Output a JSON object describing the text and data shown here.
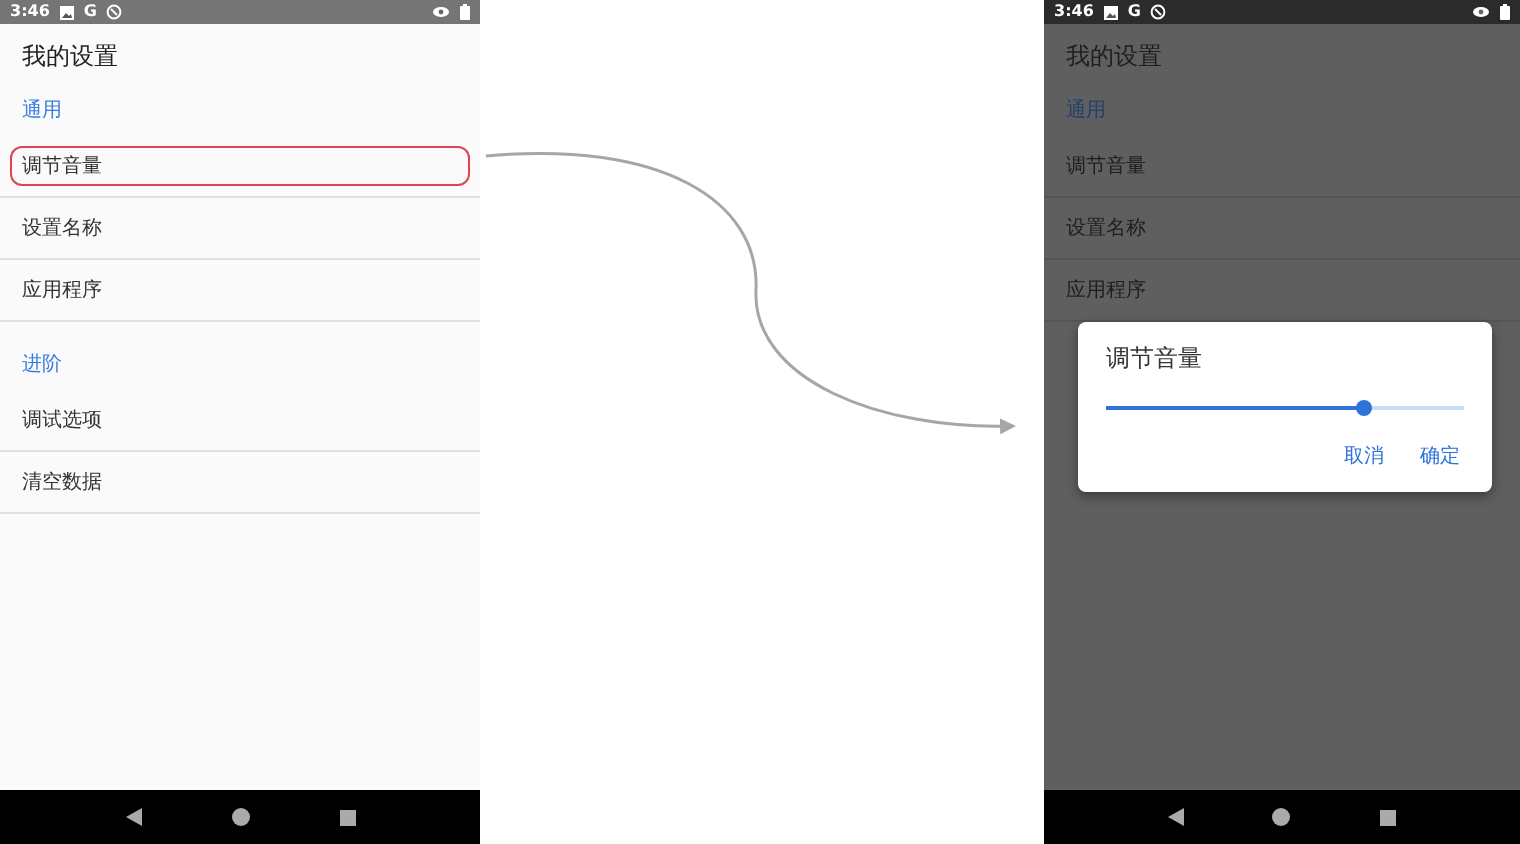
{
  "left_screen": {
    "dimmed": false,
    "status_bar": {
      "time": "3:46",
      "letter": "G"
    },
    "title": "我的设置",
    "sections": [
      {
        "header": "通用",
        "items": [
          {
            "label": "调节音量",
            "highlighted": true
          },
          {
            "label": "设置名称",
            "highlighted": false
          },
          {
            "label": "应用程序",
            "highlighted": false
          }
        ]
      },
      {
        "header": "进阶",
        "items": [
          {
            "label": "调试选项",
            "highlighted": false
          },
          {
            "label": "清空数据",
            "highlighted": false
          }
        ]
      }
    ]
  },
  "right_screen": {
    "dimmed": true,
    "status_bar": {
      "time": "3:46",
      "letter": "G"
    },
    "title": "我的设置",
    "sections": [
      {
        "header": "通用",
        "items": [
          {
            "label": "调节音量",
            "highlighted": false
          },
          {
            "label": "设置名称",
            "highlighted": false
          },
          {
            "label": "应用程序",
            "highlighted": false
          }
        ]
      }
    ],
    "dialog": {
      "title": "调节音量",
      "slider": {
        "level": 0.72
      },
      "buttons": [
        "取消",
        "确定"
      ]
    }
  }
}
